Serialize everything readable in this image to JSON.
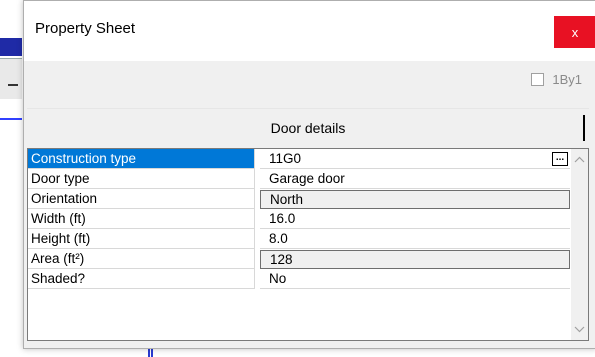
{
  "window": {
    "title": "Property Sheet",
    "close_glyph": "x"
  },
  "option": {
    "label": "1By1",
    "checked": false
  },
  "tab": {
    "label": "Door details"
  },
  "properties": [
    {
      "label": "Construction type",
      "value": "11G0",
      "selected": true,
      "readonly": false,
      "has_browse": true,
      "browse_glyph": "..."
    },
    {
      "label": "Door type",
      "value": "Garage door",
      "selected": false,
      "readonly": false
    },
    {
      "label": "Orientation",
      "value": "North",
      "selected": false,
      "readonly": true
    },
    {
      "label": "Width (ft)",
      "value": "16.0",
      "selected": false,
      "readonly": false
    },
    {
      "label": "Height (ft)",
      "value": "8.0",
      "selected": false,
      "readonly": false
    },
    {
      "label": "Area (ft²)",
      "value": "128",
      "selected": false,
      "readonly": true
    },
    {
      "label": "Shaded?",
      "value": "No",
      "selected": false,
      "readonly": false
    }
  ],
  "scrollbar": {
    "up_icon": "chevron-up-icon",
    "down_icon": "chevron-down-icon"
  },
  "colors": {
    "selection": "#0078d7",
    "close_button": "#e81123"
  }
}
